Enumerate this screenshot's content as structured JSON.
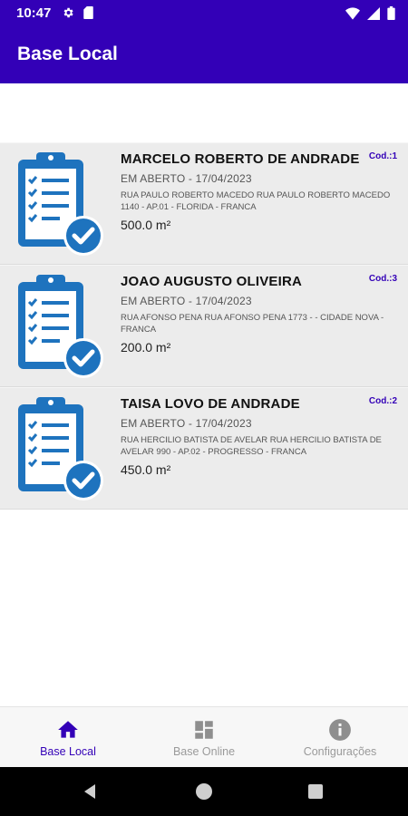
{
  "status_bar": {
    "time": "10:47",
    "icons": [
      "gear-icon",
      "sim-card-icon",
      "wifi-icon",
      "signal-icon",
      "battery-icon"
    ]
  },
  "app_bar": {
    "title": "Base Local",
    "color": "#3300b7"
  },
  "records": [
    {
      "name": "MARCELO ROBERTO DE ANDRADE",
      "code": "Cod.:1",
      "status": "EM ABERTO - 17/04/2023",
      "address": "RUA PAULO ROBERTO MACEDO RUA PAULO ROBERTO MACEDO 1140 - AP.01 - FLORIDA - FRANCA",
      "area": "500.0 m²"
    },
    {
      "name": "JOAO AUGUSTO OLIVEIRA",
      "code": "Cod.:3",
      "status": "EM ABERTO - 17/04/2023",
      "address": "RUA AFONSO PENA RUA AFONSO PENA 1773 -  - CIDADE NOVA - FRANCA",
      "area": "200.0 m²"
    },
    {
      "name": "TAISA LOVO DE ANDRADE",
      "code": "Cod.:2",
      "status": "EM ABERTO - 17/04/2023",
      "address": "RUA HERCILIO BATISTA DE AVELAR RUA HERCILIO BATISTA DE AVELAR 990 - AP.02 - PROGRESSO - FRANCA",
      "area": "450.0 m²"
    }
  ],
  "bottom_nav": {
    "items": [
      {
        "label": "Base Local",
        "icon": "home-icon",
        "active": true
      },
      {
        "label": "Base Online",
        "icon": "dashboard-icon",
        "active": false
      },
      {
        "label": "Configurações",
        "icon": "info-icon",
        "active": false
      }
    ]
  },
  "colors": {
    "primary": "#3300b7",
    "icon_blue": "#1e73be",
    "card_bg": "#ececec"
  }
}
